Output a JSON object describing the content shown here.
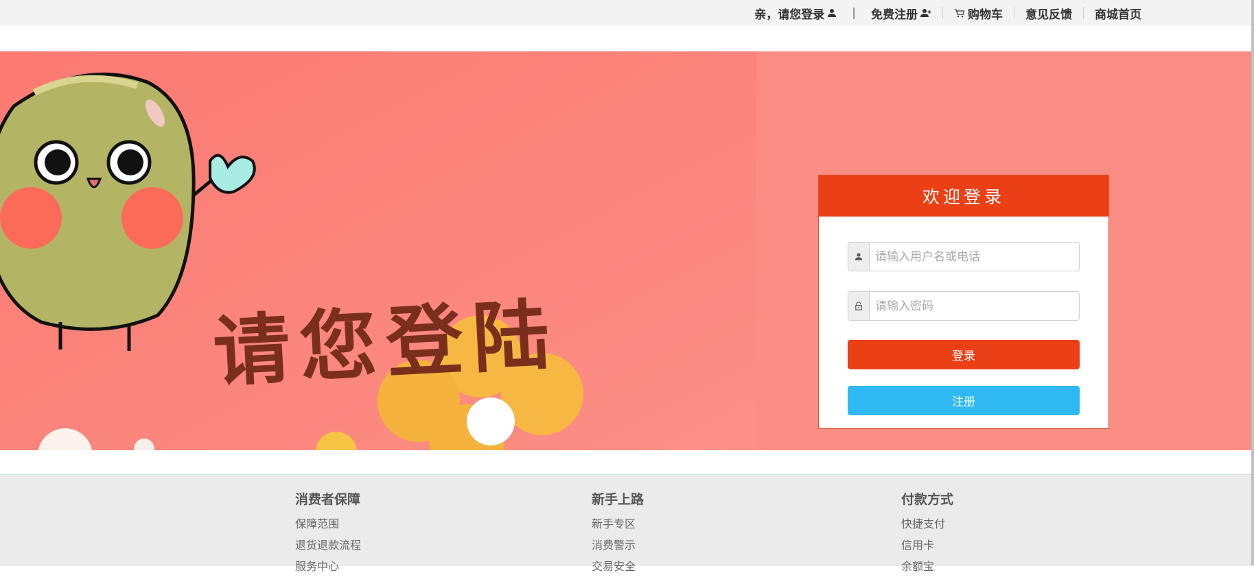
{
  "topnav": {
    "login": "亲，请您登录",
    "sep": "|",
    "register": "免费注册",
    "cart": "购物车",
    "feedback": "意见反馈",
    "home": "商城首页"
  },
  "banner": {
    "slogan": "请您登陆",
    "background_color": "#fa8b82"
  },
  "login": {
    "title": "欢迎登录",
    "username_placeholder": "请输入用户名或电话",
    "password_placeholder": "请输入密码",
    "login_button": "登录",
    "register_button": "注册",
    "accent_color": "#eb3f16",
    "register_color": "#2fb8f2"
  },
  "footer": {
    "columns": [
      {
        "title": "消费者保障",
        "links": [
          "保障范围",
          "退货退款流程",
          "服务中心"
        ]
      },
      {
        "title": "新手上路",
        "links": [
          "新手专区",
          "消费警示",
          "交易安全"
        ]
      },
      {
        "title": "付款方式",
        "links": [
          "快捷支付",
          "信用卡",
          "余额宝"
        ]
      }
    ]
  }
}
